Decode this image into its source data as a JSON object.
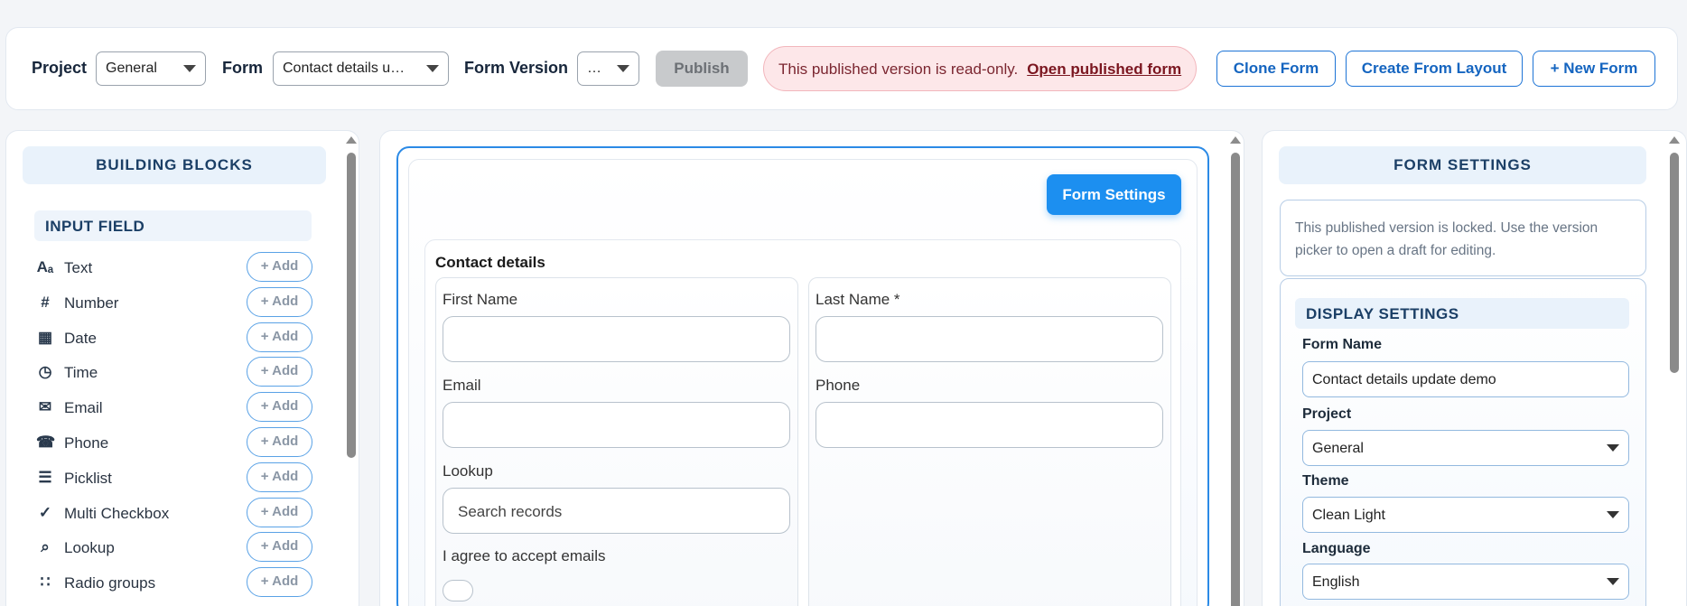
{
  "toolbar": {
    "project_label": "Project",
    "project_value": "General",
    "form_label": "Form",
    "form_value": "Contact details u…",
    "version_label": "Form Version",
    "version_value": "…",
    "publish_label": "Publish",
    "alert_text": "This published version is read-only.",
    "alert_link": "Open published form",
    "clone_label": "Clone Form",
    "layout_label": "Create From Layout",
    "new_label": "+ New Form"
  },
  "blocks": {
    "title": "BUILDING BLOCKS",
    "section": "INPUT FIELD",
    "add_label": "+ Add",
    "items": [
      {
        "label": "Text",
        "icon": "text-icon"
      },
      {
        "label": "Number",
        "icon": "number-icon"
      },
      {
        "label": "Date",
        "icon": "calendar-icon"
      },
      {
        "label": "Time",
        "icon": "clock-icon"
      },
      {
        "label": "Email",
        "icon": "envelope-icon"
      },
      {
        "label": "Phone",
        "icon": "phone-icon"
      },
      {
        "label": "Picklist",
        "icon": "list-icon"
      },
      {
        "label": "Multi Checkbox",
        "icon": "check-icon"
      },
      {
        "label": "Lookup",
        "icon": "search-icon"
      },
      {
        "label": "Radio groups",
        "icon": "radio-icon"
      }
    ]
  },
  "canvas": {
    "settings_button": "Form Settings",
    "section_title": "Contact details",
    "fields": {
      "first_name": "First Name",
      "last_name": "Last Name *",
      "email": "Email",
      "phone": "Phone",
      "lookup": "Lookup",
      "lookup_placeholder": "Search records",
      "consent": "I agree to accept emails"
    }
  },
  "settings": {
    "title": "FORM SETTINGS",
    "notice": "This published version is locked. Use the version picker to open a draft for editing.",
    "display_title": "DISPLAY SETTINGS",
    "form_name_label": "Form Name",
    "form_name_value": "Contact details update demo",
    "project_label": "Project",
    "project_value": "General",
    "theme_label": "Theme",
    "theme_value": "Clean Light",
    "language_label": "Language",
    "language_value": "English"
  },
  "colors": {
    "accent": "#1c8ff0",
    "outline_button": "#1d74d6",
    "alert_bg": "#fde7e9",
    "panel_head_bg": "#e9f2fb"
  }
}
